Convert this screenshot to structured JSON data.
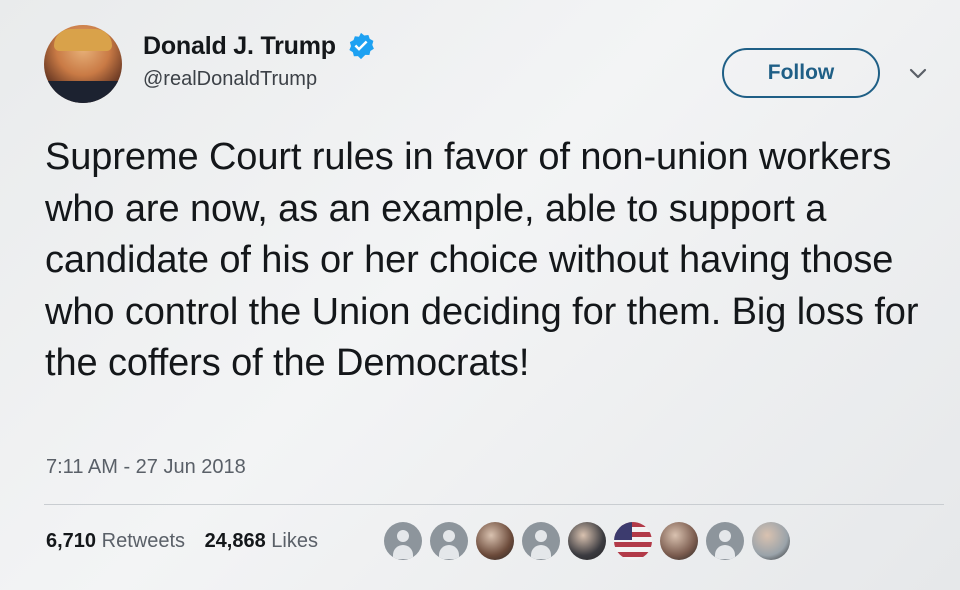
{
  "user": {
    "display_name": "Donald J. Trump",
    "handle": "@realDonaldTrump",
    "verified": true
  },
  "follow_label": "Follow",
  "tweet": {
    "text": "Supreme Court rules in favor of non-union workers who are now, as an example, able to support a candidate of his or her choice without having those who control the Union deciding for them. Big loss for the coffers of the Democrats!",
    "timestamp": "7:11 AM - 27 Jun 2018"
  },
  "stats": {
    "retweets_count": "6,710",
    "retweets_label": "Retweets",
    "likes_count": "24,868",
    "likes_label": "Likes"
  },
  "likers": [
    {
      "type": "default-avatar"
    },
    {
      "type": "default-avatar"
    },
    {
      "type": "photo",
      "color": "#6b4a3a"
    },
    {
      "type": "default-avatar"
    },
    {
      "type": "photo",
      "color": "#3b3b40"
    },
    {
      "type": "flag",
      "color": "#b23a48"
    },
    {
      "type": "photo",
      "color": "#7a5b4e"
    },
    {
      "type": "default-avatar"
    },
    {
      "type": "photo",
      "color": "#9aa3aa"
    }
  ],
  "colors": {
    "follow_blue": "#1f5f86",
    "verified_blue": "#1da1f2",
    "text": "#14171a",
    "muted": "#5a6068"
  }
}
